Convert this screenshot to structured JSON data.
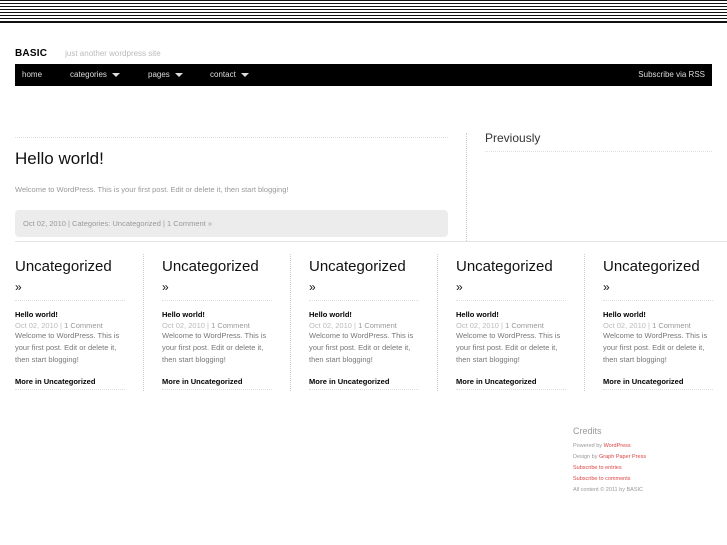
{
  "site": {
    "title": "BASIC",
    "tagline": "just another wordpress site"
  },
  "nav": {
    "items": [
      {
        "label": "home",
        "dropdown": false
      },
      {
        "label": "categories",
        "dropdown": true
      },
      {
        "label": "pages",
        "dropdown": true
      },
      {
        "label": "contact",
        "dropdown": true
      }
    ],
    "rss": "Subscribe via RSS"
  },
  "post": {
    "title": "Hello world!",
    "excerpt": "Welcome to WordPress. This is your first post. Edit or delete it, then start blogging!",
    "meta": "Oct 02, 2010 | Categories: Uncategorized | 1 Comment »"
  },
  "previously": {
    "heading": "Previously"
  },
  "categories": [
    {
      "heading": "Uncategorized",
      "arrow": "»",
      "post_title": "Hello world!",
      "date": "Oct 02, 2010 |",
      "comments": "1 Comment",
      "excerpt": "Welcome to WordPress. This is your first post. Edit or delete it, then start blogging!",
      "more": "More in Uncategorized"
    },
    {
      "heading": "Uncategorized",
      "arrow": "»",
      "post_title": "Hello world!",
      "date": "Oct 02, 2010 |",
      "comments": "1 Comment",
      "excerpt": "Welcome to WordPress. This is your first post. Edit or delete it, then start blogging!",
      "more": "More in Uncategorized"
    },
    {
      "heading": "Uncategorized",
      "arrow": "»",
      "post_title": "Hello world!",
      "date": "Oct 02, 2010 |",
      "comments": "1 Comment",
      "excerpt": "Welcome to WordPress. This is your first post. Edit or delete it, then start blogging!",
      "more": "More in Uncategorized"
    },
    {
      "heading": "Uncategorized",
      "arrow": "»",
      "post_title": "Hello world!",
      "date": "Oct 02, 2010 |",
      "comments": "1 Comment",
      "excerpt": "Welcome to WordPress. This is your first post. Edit or delete it, then start blogging!",
      "more": "More in Uncategorized"
    },
    {
      "heading": "Uncategorized",
      "arrow": "»",
      "post_title": "Hello world!",
      "date": "Oct 02, 2010 |",
      "comments": "1 Comment",
      "excerpt": "Welcome to WordPress. This is your first post. Edit or delete it, then start blogging!",
      "more": "More in Uncategorized"
    }
  ],
  "credits": {
    "heading": "Credits",
    "powered_prefix": "Powered by",
    "powered_link": "WordPress",
    "design_prefix": "Design by",
    "design_link": "Graph Paper Press",
    "subscribe_entries": "Subscribe to entries",
    "subscribe_comments": "Subscribe to comments",
    "copyright": "All content © 2011 by BASIC"
  },
  "colors": {
    "nav_bg": "#000000",
    "link_red": "#dd4444",
    "meta_bg": "#ececec"
  }
}
